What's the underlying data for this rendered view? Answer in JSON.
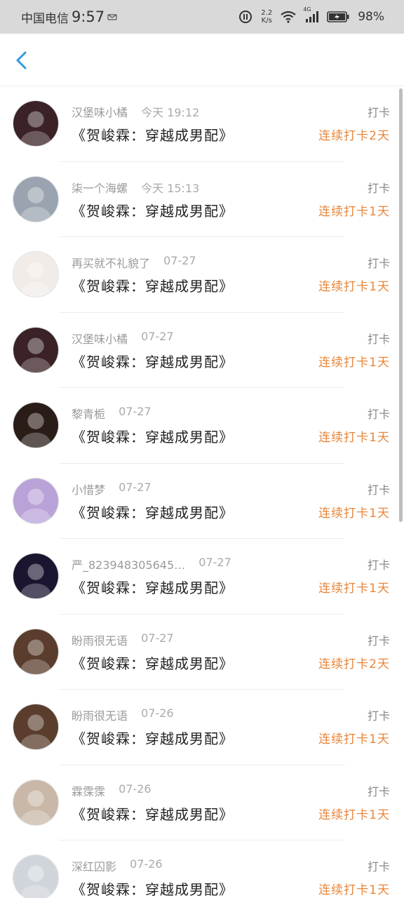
{
  "status_bar": {
    "carrier": "中国电信",
    "time": "9:57",
    "net_speed_value": "2.2",
    "net_speed_unit": "K/s",
    "signal_label": "4G",
    "battery": "98%"
  },
  "colors": {
    "accent_blue": "#2f9be0",
    "streak_orange": "#e8853a"
  },
  "items": [
    {
      "name": "汉堡味小橘",
      "time": "今天 19:12",
      "book": "《贺峻霖：穿越成男配》",
      "type": "打卡",
      "streak": "连续打卡2天",
      "avatar_color": "#3a2226"
    },
    {
      "name": "柒一个海螺",
      "time": "今天 15:13",
      "book": "《贺峻霖：穿越成男配》",
      "type": "打卡",
      "streak": "连续打卡1天",
      "avatar_color": "#9aa4b0"
    },
    {
      "name": "再买就不礼貌了",
      "time": "07-27",
      "book": "《贺峻霖：穿越成男配》",
      "type": "打卡",
      "streak": "连续打卡1天",
      "avatar_color": "#f2ece8"
    },
    {
      "name": "汉堡味小橘",
      "time": "07-27",
      "book": "《贺峻霖：穿越成男配》",
      "type": "打卡",
      "streak": "连续打卡1天",
      "avatar_color": "#3a2226"
    },
    {
      "name": "黎青栀",
      "time": "07-27",
      "book": "《贺峻霖：穿越成男配》",
      "type": "打卡",
      "streak": "连续打卡1天",
      "avatar_color": "#2a1d18"
    },
    {
      "name": "小惜梦",
      "time": "07-27",
      "book": "《贺峻霖：穿越成男配》",
      "type": "打卡",
      "streak": "连续打卡1天",
      "avatar_color": "#b9a2d8"
    },
    {
      "name": "严_823948305645…",
      "time": "07-27",
      "book": "《贺峻霖：穿越成男配》",
      "type": "打卡",
      "streak": "连续打卡1天",
      "avatar_color": "#1b1530"
    },
    {
      "name": "盼雨很无语",
      "time": "07-27",
      "book": "《贺峻霖：穿越成男配》",
      "type": "打卡",
      "streak": "连续打卡2天",
      "avatar_color": "#5a3d2c"
    },
    {
      "name": "盼雨很无语",
      "time": "07-26",
      "book": "《贺峻霖：穿越成男配》",
      "type": "打卡",
      "streak": "连续打卡1天",
      "avatar_color": "#5a3d2c"
    },
    {
      "name": "霖霂霂",
      "time": "07-26",
      "book": "《贺峻霖：穿越成男配》",
      "type": "打卡",
      "streak": "连续打卡1天",
      "avatar_color": "#c9b8a8"
    },
    {
      "name": "深红囚影",
      "time": "07-26",
      "book": "《贺峻霖：穿越成男配》",
      "type": "打卡",
      "streak": "连续打卡1天",
      "avatar_color": "#cfd5da"
    }
  ]
}
